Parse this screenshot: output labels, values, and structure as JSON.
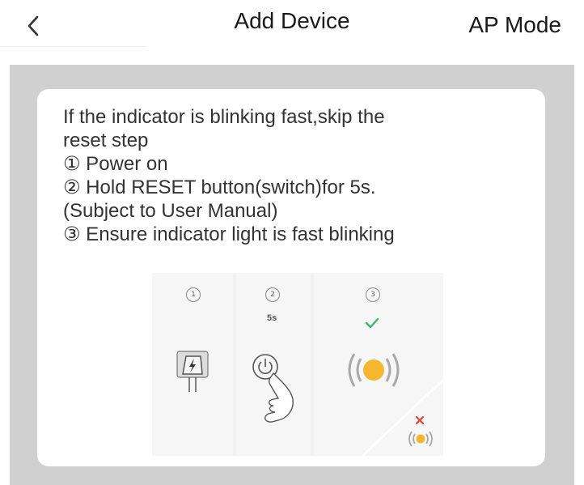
{
  "header": {
    "back_icon": "chevron-left-icon",
    "title": "Add Device",
    "mode_label": "AP Mode"
  },
  "card": {
    "lines": [
      "If the indicator is blinking fast,skip the",
      "reset step",
      "① Power on",
      "② Hold RESET button(switch)for 5s.",
      "(Subject to User Manual)",
      "③ Ensure indicator light is fast blinking"
    ]
  },
  "illustration": {
    "steps": [
      {
        "number": "1",
        "icon": "power-plug-icon"
      },
      {
        "number": "2",
        "label": "5s",
        "icon": "press-power-button-icon"
      },
      {
        "number": "3",
        "icon": "blinking-light-icon",
        "check_icon": "check-icon",
        "wrong_icon": "cross-icon"
      }
    ],
    "colors": {
      "light": "#f5b72e",
      "check": "#3cb371",
      "cross": "#e0453a"
    }
  }
}
